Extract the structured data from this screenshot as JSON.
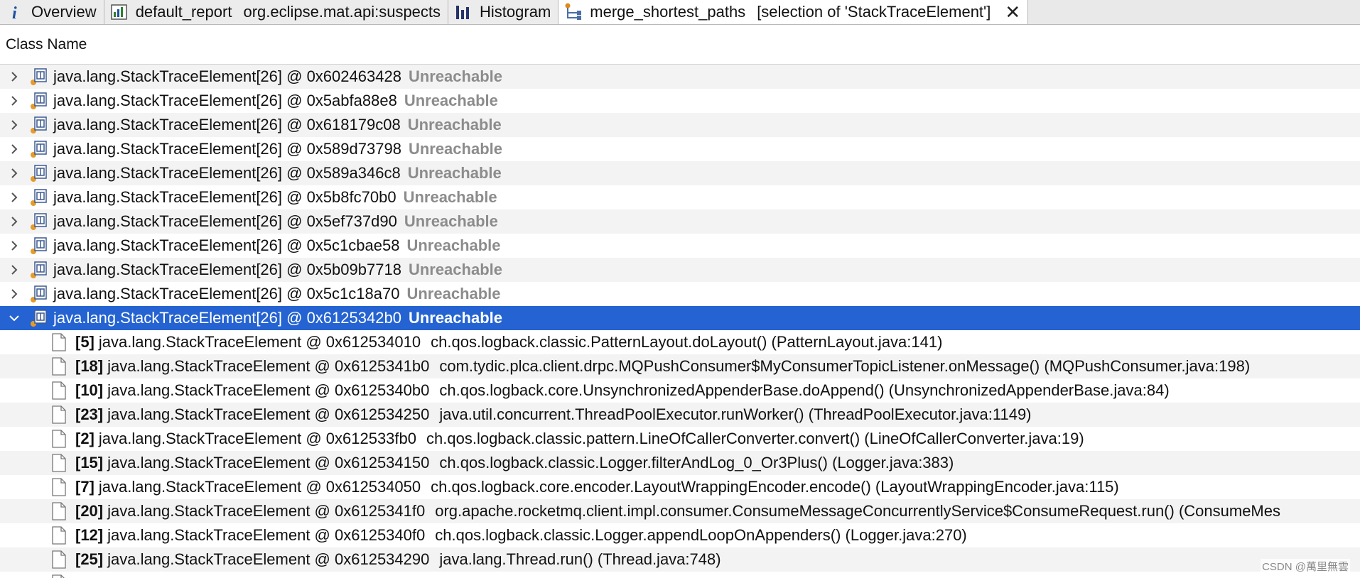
{
  "tabs": [
    {
      "label": "Overview",
      "icon": "info-icon",
      "active": false
    },
    {
      "label": "default_report",
      "label2": "org.eclipse.mat.api:suspects",
      "icon": "report-icon",
      "active": false
    },
    {
      "label": "Histogram",
      "icon": "histogram-icon",
      "active": false
    },
    {
      "label": "merge_shortest_paths",
      "label2": "[selection of 'StackTraceElement']",
      "icon": "merge-paths-icon",
      "active": true,
      "closable": true
    }
  ],
  "column_header": "Class Name",
  "rows": [
    {
      "label": "java.lang.StackTraceElement[26] @ 0x602463428",
      "status": "Unreachable",
      "expanded": false
    },
    {
      "label": "java.lang.StackTraceElement[26] @ 0x5abfa88e8",
      "status": "Unreachable",
      "expanded": false
    },
    {
      "label": "java.lang.StackTraceElement[26] @ 0x618179c08",
      "status": "Unreachable",
      "expanded": false
    },
    {
      "label": "java.lang.StackTraceElement[26] @ 0x589d73798",
      "status": "Unreachable",
      "expanded": false
    },
    {
      "label": "java.lang.StackTraceElement[26] @ 0x589a346c8",
      "status": "Unreachable",
      "expanded": false
    },
    {
      "label": "java.lang.StackTraceElement[26] @ 0x5b8fc70b0",
      "status": "Unreachable",
      "expanded": false
    },
    {
      "label": "java.lang.StackTraceElement[26] @ 0x5ef737d90",
      "status": "Unreachable",
      "expanded": false
    },
    {
      "label": "java.lang.StackTraceElement[26] @ 0x5c1cbae58",
      "status": "Unreachable",
      "expanded": false
    },
    {
      "label": "java.lang.StackTraceElement[26] @ 0x5b09b7718",
      "status": "Unreachable",
      "expanded": false
    },
    {
      "label": "java.lang.StackTraceElement[26] @ 0x5c1c18a70",
      "status": "Unreachable",
      "expanded": false
    },
    {
      "label": "java.lang.StackTraceElement[26] @ 0x6125342b0",
      "status": "Unreachable",
      "expanded": true,
      "selected": true
    }
  ],
  "children": [
    {
      "index": "[5]",
      "addr": "java.lang.StackTraceElement @ 0x612534010",
      "desc": "ch.qos.logback.classic.PatternLayout.doLayout() (PatternLayout.java:141)"
    },
    {
      "index": "[18]",
      "addr": "java.lang.StackTraceElement @ 0x6125341b0",
      "desc": "com.tydic.plca.client.drpc.MQPushConsumer$MyConsumerTopicListener.onMessage() (MQPushConsumer.java:198)"
    },
    {
      "index": "[10]",
      "addr": "java.lang.StackTraceElement @ 0x6125340b0",
      "desc": "ch.qos.logback.core.UnsynchronizedAppenderBase.doAppend() (UnsynchronizedAppenderBase.java:84)"
    },
    {
      "index": "[23]",
      "addr": "java.lang.StackTraceElement @ 0x612534250",
      "desc": "java.util.concurrent.ThreadPoolExecutor.runWorker() (ThreadPoolExecutor.java:1149)"
    },
    {
      "index": "[2]",
      "addr": "java.lang.StackTraceElement @ 0x612533fb0",
      "desc": "ch.qos.logback.classic.pattern.LineOfCallerConverter.convert() (LineOfCallerConverter.java:19)"
    },
    {
      "index": "[15]",
      "addr": "java.lang.StackTraceElement @ 0x612534150",
      "desc": "ch.qos.logback.classic.Logger.filterAndLog_0_Or3Plus() (Logger.java:383)"
    },
    {
      "index": "[7]",
      "addr": "java.lang.StackTraceElement @ 0x612534050",
      "desc": "ch.qos.logback.core.encoder.LayoutWrappingEncoder.encode() (LayoutWrappingEncoder.java:115)"
    },
    {
      "index": "[20]",
      "addr": "java.lang.StackTraceElement @ 0x6125341f0",
      "desc": "org.apache.rocketmq.client.impl.consumer.ConsumeMessageConcurrentlyService$ConsumeRequest.run() (ConsumeMes"
    },
    {
      "index": "[12]",
      "addr": "java.lang.StackTraceElement @ 0x6125340f0",
      "desc": "ch.qos.logback.classic.Logger.appendLoopOnAppenders() (Logger.java:270)"
    },
    {
      "index": "[25]",
      "addr": "java.lang.StackTraceElement @ 0x612534290",
      "desc": "java.lang.Thread.run() (Thread.java:748)"
    }
  ],
  "watermark": "CSDN @萬里無雲",
  "colors": {
    "selection": "#2463d1",
    "status_text": "#8c8c8c"
  }
}
